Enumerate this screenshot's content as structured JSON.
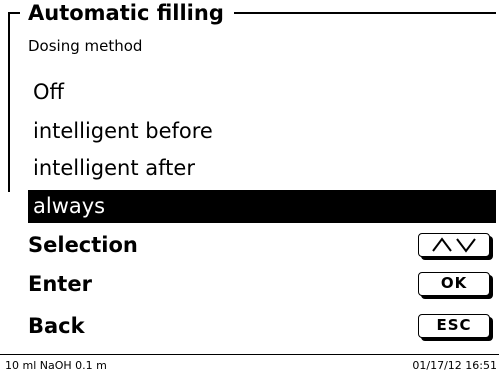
{
  "header": {
    "title": "Automatic filling",
    "subtitle": "Dosing method"
  },
  "options": [
    {
      "label": "Off",
      "selected": false
    },
    {
      "label": "intelligent before",
      "selected": false
    },
    {
      "label": "intelligent after",
      "selected": false
    },
    {
      "label": "always",
      "selected": true
    }
  ],
  "controls": {
    "selection": {
      "label": "Selection",
      "key_icon": "up-down-arrows-icon"
    },
    "enter": {
      "label": "Enter",
      "key_label": "OK"
    },
    "back": {
      "label": "Back",
      "key_label": "ESC"
    }
  },
  "status_bar": {
    "left": "10 ml NaOH 0.1 m",
    "right": "01/17/12 16:51"
  }
}
